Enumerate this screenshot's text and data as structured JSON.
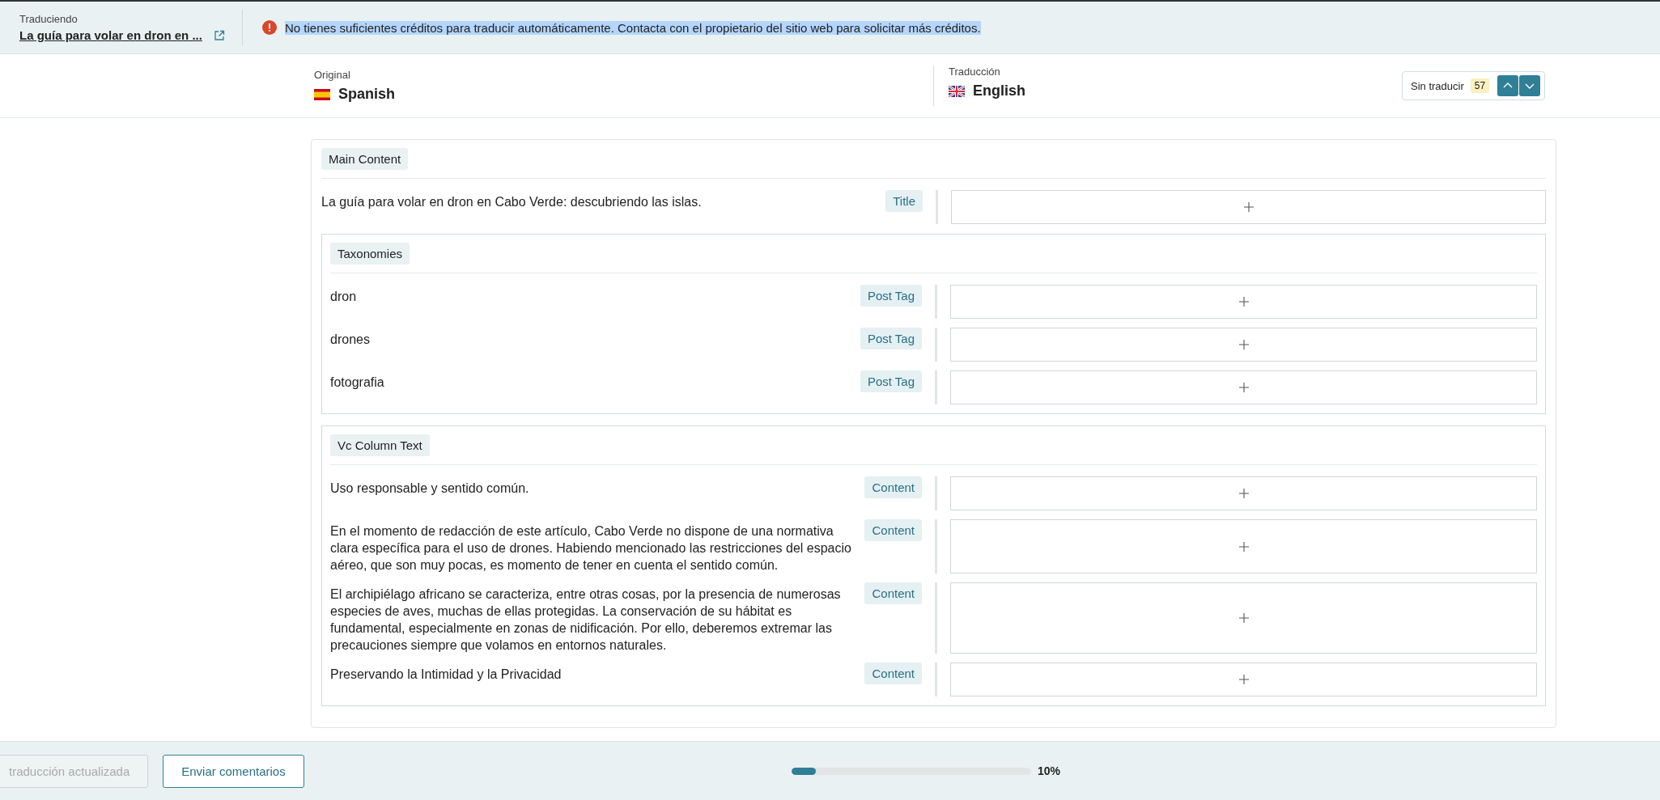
{
  "top_bar": {
    "label": "Traduciendo",
    "title": "La guía para volar en dron en ...",
    "alert": {
      "text": "No tienes suficientes créditos para traducir automáticamente. Contacta con el propietario del sitio web para solicitar más créditos.",
      "highlighted": true
    }
  },
  "languages": {
    "original": {
      "label": "Original",
      "name": "Spanish"
    },
    "translation": {
      "label": "Traducción",
      "name": "English"
    },
    "untranslated": {
      "label": "Sin traducir",
      "count": "57"
    }
  },
  "section": {
    "title": "Main Content",
    "items": [
      {
        "kind": "row",
        "text": "La guía para volar en dron en Cabo Verde: descubriendo las islas.",
        "tag": "Title"
      },
      {
        "kind": "group",
        "title": "Taxonomies",
        "rows": [
          {
            "text": "dron",
            "tag": "Post Tag"
          },
          {
            "text": "drones",
            "tag": "Post Tag"
          },
          {
            "text": "fotografia",
            "tag": "Post Tag"
          }
        ]
      },
      {
        "kind": "group",
        "title": "Vc Column Text",
        "rows": [
          {
            "text": "Uso responsable y sentido común.",
            "tag": "Content"
          },
          {
            "text": "En el momento de redacción de este artículo, Cabo Verde no dispone de una normativa clara específica para el uso de drones. Habiendo mencionado las restricciones del espacio aéreo, que son muy pocas, es momento de tener en cuenta el sentido común.",
            "tag": "Content"
          },
          {
            "text": "El archipiélago africano se caracteriza, entre otras cosas, por la presencia de numerosas especies de aves, muchas de ellas protegidas. La conservación de su hábitat es fundamental, especialmente en zonas de nidificación. Por ello, deberemos extremar las precauciones siempre que volamos en entornos naturales.",
            "tag": "Content"
          },
          {
            "text": "Preservando la Intimidad y la Privacidad",
            "tag": "Content"
          }
        ]
      }
    ]
  },
  "footer": {
    "buttons": [
      {
        "label": "traducción actualizada",
        "disabled": true
      },
      {
        "label": "Enviar comentarios",
        "disabled": false
      }
    ],
    "progress": {
      "level": 0.1,
      "reading": "10%"
    }
  }
}
